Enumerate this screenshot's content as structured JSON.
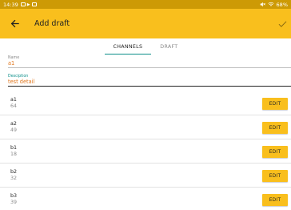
{
  "status_bar": {
    "time": "14:39",
    "battery": "68%",
    "left_icons": [
      "image-icon",
      "play-icon",
      "gallery-icon"
    ],
    "right_icons": [
      "mute-icon",
      "wifi-icon"
    ]
  },
  "app_bar": {
    "title": "Add draft",
    "background": "#f9bf1d",
    "back_icon": "arrow-left-icon",
    "confirm_icon": "check-icon"
  },
  "tabs": [
    {
      "label": "CHANNELS",
      "active": true
    },
    {
      "label": "DRAFT",
      "active": false
    }
  ],
  "form": {
    "name": {
      "label": "Name",
      "value": "a1"
    },
    "description": {
      "label": "Desciption",
      "value": "test detail"
    }
  },
  "channels": [
    {
      "name": "a1",
      "value": "64",
      "button": "EDIT"
    },
    {
      "name": "a2",
      "value": "49",
      "button": "EDIT"
    },
    {
      "name": "b1",
      "value": "18",
      "button": "EDIT"
    },
    {
      "name": "b2",
      "value": "32",
      "button": "EDIT"
    },
    {
      "name": "b3",
      "value": "39",
      "button": "EDIT"
    }
  ],
  "colors": {
    "accent": "#f9bf1d",
    "status_bar": "#cd9a05",
    "tab_indicator": "#0d8f8a",
    "input_text": "#e0761c"
  }
}
